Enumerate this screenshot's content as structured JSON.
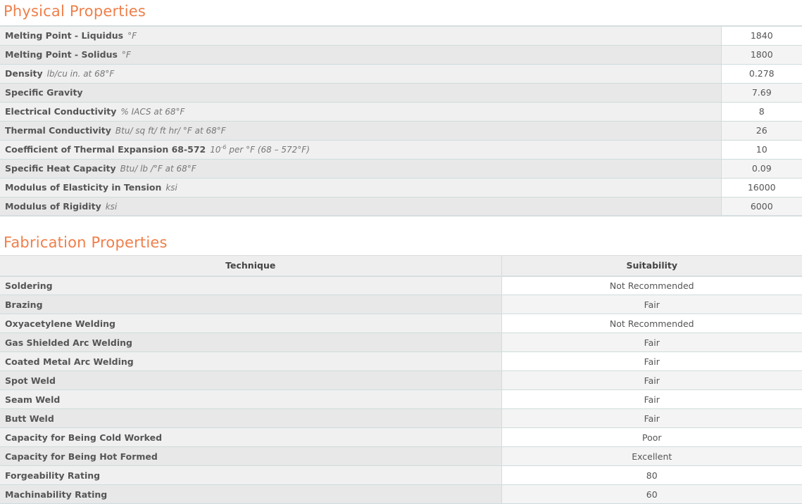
{
  "physical": {
    "title": "Physical Properties",
    "rows": [
      {
        "name": "Melting Point - Liquidus",
        "unit": "°F",
        "value": "1840"
      },
      {
        "name": "Melting Point - Solidus",
        "unit": "°F",
        "value": "1800"
      },
      {
        "name": "Density",
        "unit": "lb/cu in. at 68°F",
        "value": "0.278"
      },
      {
        "name": "Specific Gravity",
        "unit": "",
        "value": "7.69"
      },
      {
        "name": "Electrical Conductivity",
        "unit": "% IACS at 68°F",
        "value": "8"
      },
      {
        "name": "Thermal Conductivity",
        "unit": "Btu/ sq ft/ ft hr/ °F at 68°F",
        "value": "26"
      },
      {
        "name": "Coefficient of Thermal Expansion 68-572",
        "unit_base": "10",
        "unit_exp": "-6",
        "unit_rest": "per °F (68 – 572°F)",
        "value": "10"
      },
      {
        "name": "Specific Heat Capacity",
        "unit": "Btu/ lb /°F at 68°F",
        "value": "0.09"
      },
      {
        "name": "Modulus of Elasticity in Tension",
        "unit": "ksi",
        "value": "16000"
      },
      {
        "name": "Modulus of Rigidity",
        "unit": "ksi",
        "value": "6000"
      }
    ]
  },
  "fabrication": {
    "title": "Fabrication Properties",
    "headers": {
      "technique": "Technique",
      "suitability": "Suitability"
    },
    "rows": [
      {
        "technique": "Soldering",
        "suitability": "Not Recommended"
      },
      {
        "technique": "Brazing",
        "suitability": "Fair"
      },
      {
        "technique": "Oxyacetylene Welding",
        "suitability": "Not Recommended"
      },
      {
        "technique": "Gas Shielded Arc Welding",
        "suitability": "Fair"
      },
      {
        "technique": "Coated Metal Arc Welding",
        "suitability": "Fair"
      },
      {
        "technique": "Spot Weld",
        "suitability": "Fair"
      },
      {
        "technique": "Seam Weld",
        "suitability": "Fair"
      },
      {
        "technique": "Butt Weld",
        "suitability": "Fair"
      },
      {
        "technique": "Capacity for Being Cold Worked",
        "suitability": "Poor"
      },
      {
        "technique": "Capacity for Being Hot Formed",
        "suitability": "Excellent"
      },
      {
        "technique": "Forgeability Rating",
        "suitability": "80"
      },
      {
        "technique": "Machinability Rating",
        "suitability": "60"
      }
    ]
  },
  "colors": {
    "accent": "#ef7f4a",
    "border": "#cfdcdc",
    "label_bg": "#eeeeee",
    "text": "#555555"
  }
}
